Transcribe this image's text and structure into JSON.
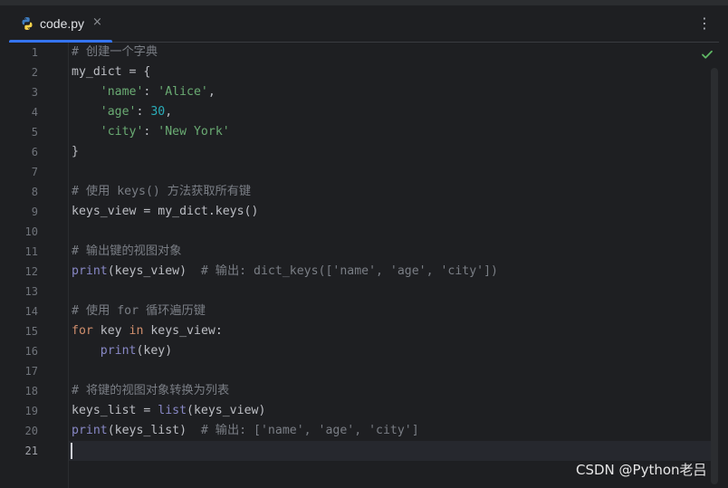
{
  "tab": {
    "filename": "code.py",
    "close_glyph": "×",
    "icon": "python-file-icon"
  },
  "menu": {
    "more_glyph": "⋮",
    "icon": "more-vertical-icon"
  },
  "status": {
    "icon": "check-icon",
    "color": "#5fb865"
  },
  "colors": {
    "background": "#1e1f22",
    "accent": "#3574f0",
    "comment": "#7a7e85",
    "keyword": "#cf8e6d",
    "string": "#6aab73",
    "number": "#2aacb8",
    "builtin": "#8888c6",
    "text": "#bcbec4"
  },
  "editor": {
    "active_line": 21,
    "lines": [
      {
        "n": "1",
        "tokens": [
          {
            "t": "comment",
            "v": "# 创建一个字典"
          }
        ]
      },
      {
        "n": "2",
        "tokens": [
          {
            "t": "plain",
            "v": "my_dict = {"
          }
        ]
      },
      {
        "n": "3",
        "tokens": [
          {
            "t": "plain",
            "v": "    "
          },
          {
            "t": "string",
            "v": "'name'"
          },
          {
            "t": "plain",
            "v": ": "
          },
          {
            "t": "string",
            "v": "'Alice'"
          },
          {
            "t": "plain",
            "v": ","
          }
        ]
      },
      {
        "n": "4",
        "tokens": [
          {
            "t": "plain",
            "v": "    "
          },
          {
            "t": "string",
            "v": "'age'"
          },
          {
            "t": "plain",
            "v": ": "
          },
          {
            "t": "number",
            "v": "30"
          },
          {
            "t": "plain",
            "v": ","
          }
        ]
      },
      {
        "n": "5",
        "tokens": [
          {
            "t": "plain",
            "v": "    "
          },
          {
            "t": "string",
            "v": "'city'"
          },
          {
            "t": "plain",
            "v": ": "
          },
          {
            "t": "string",
            "v": "'New York'"
          }
        ]
      },
      {
        "n": "6",
        "tokens": [
          {
            "t": "plain",
            "v": "}"
          }
        ]
      },
      {
        "n": "7",
        "tokens": []
      },
      {
        "n": "8",
        "tokens": [
          {
            "t": "comment",
            "v": "# 使用 keys() 方法获取所有键"
          }
        ]
      },
      {
        "n": "9",
        "tokens": [
          {
            "t": "plain",
            "v": "keys_view = my_dict.keys()"
          }
        ]
      },
      {
        "n": "10",
        "tokens": []
      },
      {
        "n": "11",
        "tokens": [
          {
            "t": "comment",
            "v": "# 输出键的视图对象"
          }
        ]
      },
      {
        "n": "12",
        "tokens": [
          {
            "t": "builtin",
            "v": "print"
          },
          {
            "t": "plain",
            "v": "(keys_view)  "
          },
          {
            "t": "comment",
            "v": "# 输出: dict_keys(['name', 'age', 'city'])"
          }
        ]
      },
      {
        "n": "13",
        "tokens": []
      },
      {
        "n": "14",
        "tokens": [
          {
            "t": "comment",
            "v": "# 使用 for 循环遍历键"
          }
        ]
      },
      {
        "n": "15",
        "tokens": [
          {
            "t": "keyword",
            "v": "for"
          },
          {
            "t": "plain",
            "v": " key "
          },
          {
            "t": "keyword",
            "v": "in"
          },
          {
            "t": "plain",
            "v": " keys_view:"
          }
        ]
      },
      {
        "n": "16",
        "tokens": [
          {
            "t": "plain",
            "v": "    "
          },
          {
            "t": "builtin",
            "v": "print"
          },
          {
            "t": "plain",
            "v": "(key)"
          }
        ]
      },
      {
        "n": "17",
        "tokens": []
      },
      {
        "n": "18",
        "tokens": [
          {
            "t": "comment",
            "v": "# 将键的视图对象转换为列表"
          }
        ]
      },
      {
        "n": "19",
        "tokens": [
          {
            "t": "plain",
            "v": "keys_list = "
          },
          {
            "t": "builtin",
            "v": "list"
          },
          {
            "t": "plain",
            "v": "(keys_view)"
          }
        ]
      },
      {
        "n": "20",
        "tokens": [
          {
            "t": "builtin",
            "v": "print"
          },
          {
            "t": "plain",
            "v": "(keys_list)  "
          },
          {
            "t": "comment",
            "v": "# 输出: ['name', 'age', 'city']"
          }
        ]
      },
      {
        "n": "21",
        "tokens": []
      }
    ]
  },
  "watermark": {
    "text": "CSDN @Python老吕"
  }
}
